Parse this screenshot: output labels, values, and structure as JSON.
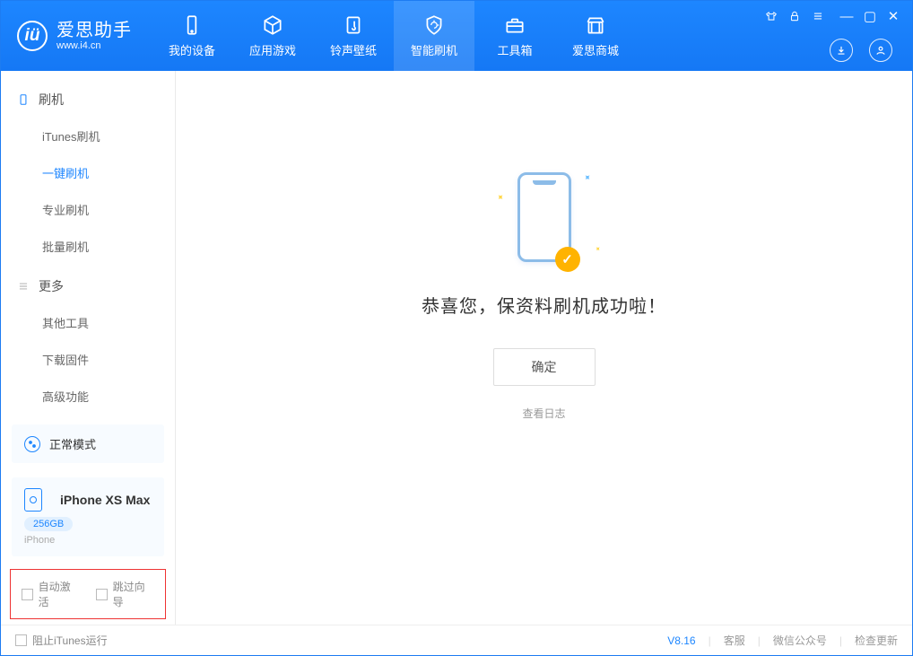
{
  "app": {
    "name": "爱思助手",
    "url": "www.i4.cn"
  },
  "nav": {
    "items": [
      {
        "label": "我的设备"
      },
      {
        "label": "应用游戏"
      },
      {
        "label": "铃声壁纸"
      },
      {
        "label": "智能刷机"
      },
      {
        "label": "工具箱"
      },
      {
        "label": "爱思商城"
      }
    ]
  },
  "sidebar": {
    "sectionFlash": "刷机",
    "items": [
      {
        "label": "iTunes刷机"
      },
      {
        "label": "一键刷机"
      },
      {
        "label": "专业刷机"
      },
      {
        "label": "批量刷机"
      }
    ],
    "sectionMore": "更多",
    "moreItems": [
      {
        "label": "其他工具"
      },
      {
        "label": "下载固件"
      },
      {
        "label": "高级功能"
      }
    ],
    "mode": "正常模式",
    "device": {
      "name": "iPhone XS Max",
      "capacity": "256GB",
      "type": "iPhone"
    },
    "checks": {
      "autoActivate": "自动激活",
      "skipGuide": "跳过向导"
    }
  },
  "main": {
    "message": "恭喜您，保资料刷机成功啦！",
    "okBtn": "确定",
    "viewLog": "查看日志"
  },
  "footer": {
    "blockItunes": "阻止iTunes运行",
    "version": "V8.16",
    "support": "客服",
    "wechat": "微信公众号",
    "update": "检查更新"
  }
}
